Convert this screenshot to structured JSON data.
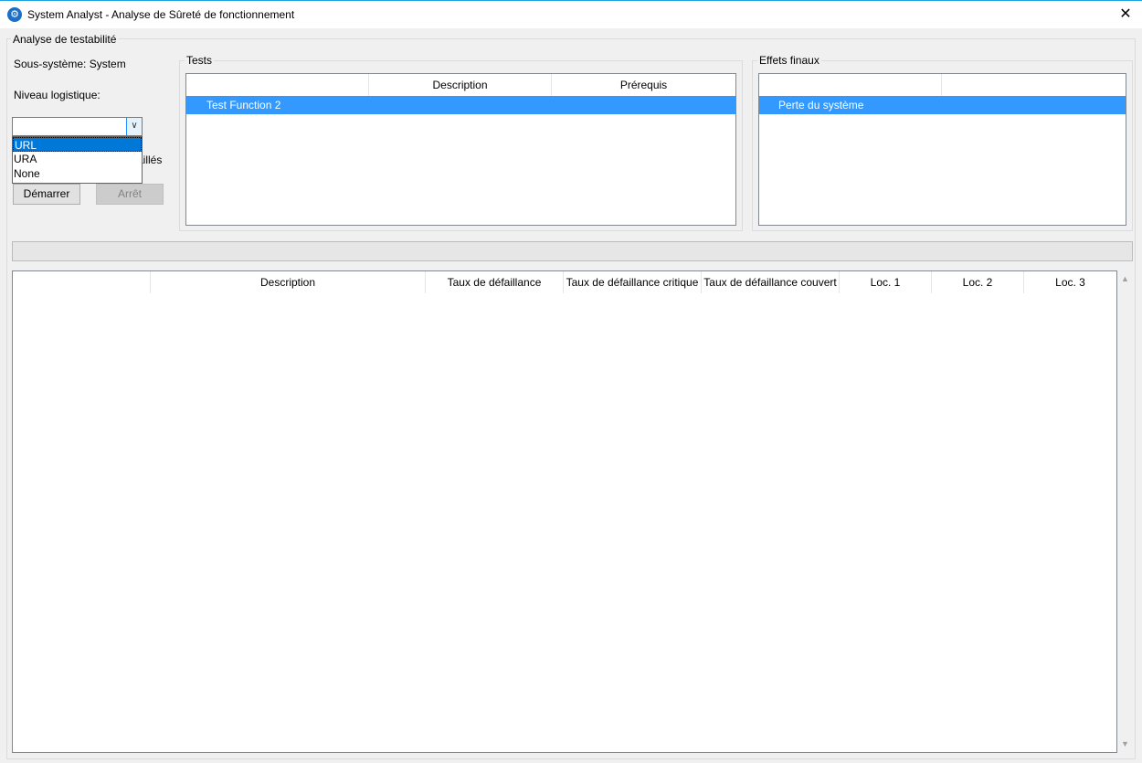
{
  "window": {
    "title": "System Analyst - Analyse de Sûreté de fonctionnement",
    "close_glyph": "✕",
    "app_icon": "gear-icon"
  },
  "analysis": {
    "group_label": "Analyse de testabilité",
    "subsystem_label": "Sous-système: System",
    "logistic_level_label": "Niveau logistique:",
    "combo_value": "",
    "combo_options": [
      "URL",
      "URA",
      "None"
    ],
    "partial_checkbox_text": "aillés",
    "start_button": "Démarrer",
    "stop_button": "Arrêt"
  },
  "tests": {
    "label": "Tests",
    "columns": [
      "",
      "Description",
      "Prérequis"
    ],
    "rows": [
      {
        "name": "Test Function 2",
        "description": "",
        "prereq": ""
      }
    ]
  },
  "final_effects": {
    "label": "Effets finaux",
    "columns": [
      "",
      ""
    ],
    "rows": [
      {
        "name": "Perte du système"
      }
    ]
  },
  "progress": {
    "value": 0
  },
  "results": {
    "columns": [
      "",
      "Description",
      "Taux de défaillance",
      "Taux de défaillance critique",
      "Taux de défaillance couvert",
      "Loc. 1",
      "Loc. 2",
      "Loc. 3"
    ],
    "rows": []
  },
  "colors": {
    "selection": "#3399ff",
    "window_bg": "#f0f0f0",
    "title_border": "#1ba1e2"
  }
}
